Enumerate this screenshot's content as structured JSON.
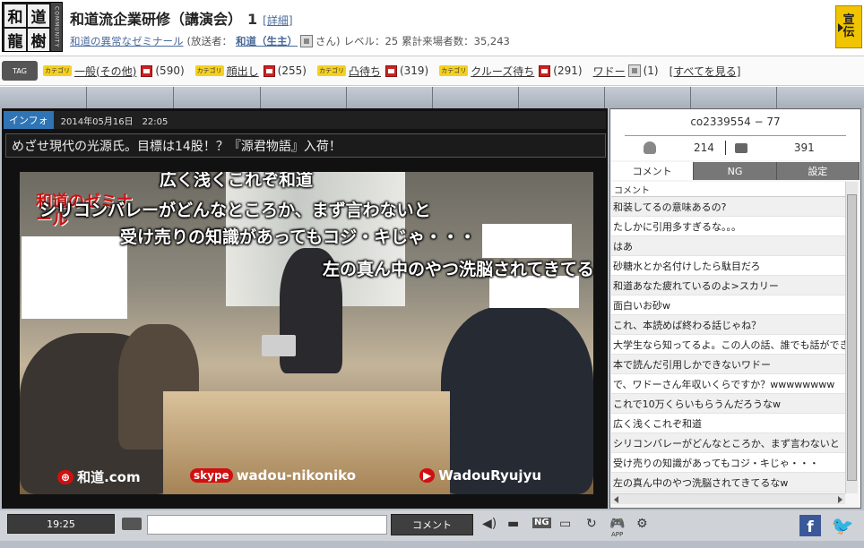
{
  "header": {
    "logo": {
      "chars": [
        "和",
        "道",
        "龍",
        "樹"
      ],
      "side_text": "COMMUNITY"
    },
    "title": "和道流企業研修（講演会）",
    "title_num": "1",
    "detail_link": "[詳細]",
    "community_name": "和道の異常なゼミナール",
    "broadcaster_label": "(放送者：",
    "broadcaster_name": "和道（生主）",
    "san": "さん)",
    "level": "レベル：25",
    "visitors": "累計来場者数：35,243",
    "ad_button": {
      "line1": "宣",
      "line2": "伝"
    }
  },
  "tags": {
    "label": "TAG",
    "category_badge": "カテゴリ",
    "items": [
      {
        "name": "一般(その他)",
        "count": "(590)",
        "category": true
      },
      {
        "name": "顔出し",
        "count": "(255)",
        "category": true
      },
      {
        "name": "凸待ち",
        "count": "(319)",
        "category": true
      },
      {
        "name": "クルーズ待ち",
        "count": "(291)",
        "category": true
      },
      {
        "name": "ワドー",
        "count": "(1)",
        "category": false
      }
    ],
    "see_all": "[すべてを見る]"
  },
  "player": {
    "info_tab": "インフォ",
    "date": "2014年05月16日　22:05",
    "headline": "めざせ現代の光源氏。目標は14股！？『源君物語』入荷！",
    "watermark_logo": "和道のゼミナール",
    "watermarks": [
      "和道.com",
      "wadou-nikoniko",
      "WadouRyujyu"
    ],
    "skype_label": "skype",
    "overlay_comments": [
      "広く浅くこれぞ和道",
      "シリコンバレーがどんなところか、まず言わないと",
      "受け売りの知識があってもコジ・キじゃ・・・",
      "左の真ん中のやつ洗脳されてきてるなw"
    ]
  },
  "side": {
    "community_id": "co2339554 − 77",
    "viewers": "214",
    "comments_count": "391",
    "tabs": [
      "コメント",
      "NG",
      "設定"
    ],
    "list_header": "コメント",
    "comments": [
      "和装してるの意味あるの?",
      "たしかに引用多すぎるな。。。",
      "はあ",
      "砂糖水とか名付けしたら駄目だろ",
      "和道あなた疲れているのよ>スカリー",
      "面白いお砂w",
      "これ、本読めば終わる話じゃね？",
      "大学生なら知ってるよ。この人の話、誰でも話ができる",
      "本で読んだ引用しかできないワドー",
      "で、ワドーさん年収いくらですか？wwwwwwww",
      "これで10万くらいもらうんだろうなw",
      "広く浅くこれぞ和道",
      "シリコンバレーがどんなところか、まず言わないと",
      "受け売りの知識があってもコジ・キじゃ・・・",
      "左の真ん中のやつ洗脳されてきてるなw"
    ]
  },
  "controls": {
    "time": "19:25",
    "comment_placeholder": "",
    "comment_button": "コメント",
    "ng_label": "NG",
    "app_label": "APP",
    "facebook_label": "f"
  }
}
